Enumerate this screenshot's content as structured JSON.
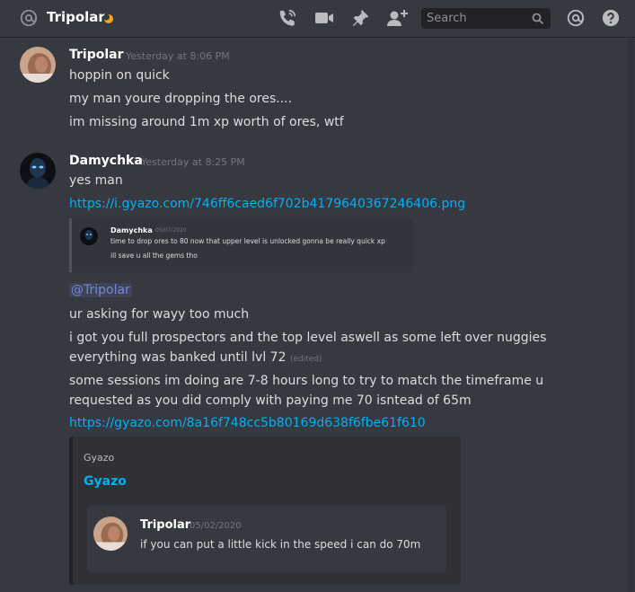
{
  "channel": {
    "name": "Tripolar"
  },
  "search": {
    "placeholder": "Search"
  },
  "messages": [
    {
      "author": "Tripolar",
      "timestamp": "Yesterday at 8:06 PM",
      "lines": [
        "hoppin on quick",
        "my man youre dropping the ores....",
        "im missing around 1m xp worth of ores, wtf"
      ]
    },
    {
      "author": "Damychka",
      "timestamp": "Yesterday at 8:25 PM",
      "lines": [
        "yes man"
      ],
      "link1": "https://i.gyazo.com/746ff6caed6f702b4179640367246406.png",
      "quote": {
        "author": "Damychka",
        "date": "05/07/2020",
        "lines": [
          "time to drop ores to 80 now that upper level is unlocked gonna be really quick xp",
          "ill save u all the gems tho"
        ]
      },
      "mention": "@Tripolar",
      "body": [
        "ur asking for wayy too much",
        "i got you full prospectors and the top level aswell as some left over nuggies",
        "everything was banked until lvl 72",
        "some sessions im doing are 7-8 hours long to try to match the timeframe u",
        "requested as you did comply with paying me 70 isntead of 65m"
      ],
      "edited": "(edited)",
      "link2": "https://gyazo.com/8a16f748cc5b80169d638f6fbe61f610",
      "embed": {
        "provider": "Gyazo",
        "title": "Gyazo",
        "inner_author": "Tripolar",
        "inner_date": "05/02/2020",
        "inner_text": "if you can put a little kick in the speed i can do 70m"
      }
    }
  ]
}
